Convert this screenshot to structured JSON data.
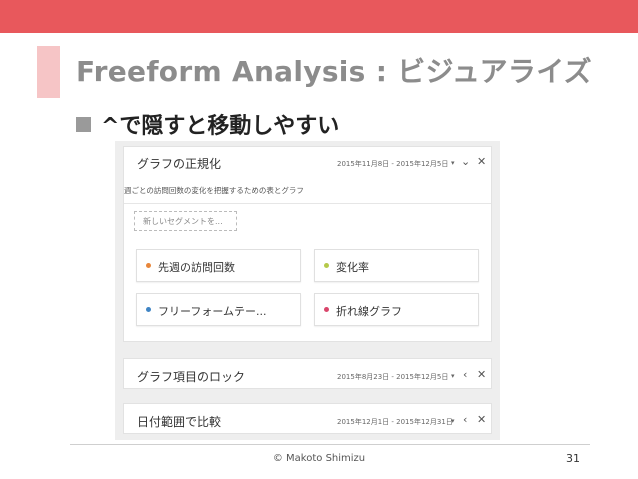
{
  "slide": {
    "title": "Freeform Analysis : ビジュアライズ",
    "bullet": "^で隠すと移動しやすい",
    "copyright": "© Makoto Shimizu",
    "page_number": "31",
    "colors": {
      "top_bar": "#e8585c",
      "accent": "#f6c5c6"
    }
  },
  "screen": {
    "main_card": {
      "title": "グラフの正規化",
      "date_range": "2015年11月8日 - 2015年12月5日",
      "subtitle": "週ごとの訪問回数の変化を把握するための表とグラフ",
      "segment_placeholder": "新しいセグメントを...",
      "metrics": [
        {
          "label": "先週の訪問回数",
          "color": "#e8863a"
        },
        {
          "label": "変化率",
          "color": "#b5c94a"
        },
        {
          "label": "フリーフォームテー...",
          "color": "#3f84c4"
        },
        {
          "label": "折れ線グラフ",
          "color": "#d9456b"
        }
      ],
      "icons": {
        "expand": "chevron-down-icon",
        "close": "close-icon"
      }
    },
    "lock_card": {
      "title": "グラフ項目のロック",
      "date_range": "2015年8月23日 - 2015年12月5日",
      "icons": {
        "collapse": "chevron-left-icon",
        "close": "close-icon"
      }
    },
    "compare_card": {
      "title": "日付範囲で比較",
      "date_range": "2015年12月1日 - 2015年12月31日",
      "icons": {
        "collapse": "chevron-left-icon",
        "close": "close-icon"
      }
    }
  }
}
